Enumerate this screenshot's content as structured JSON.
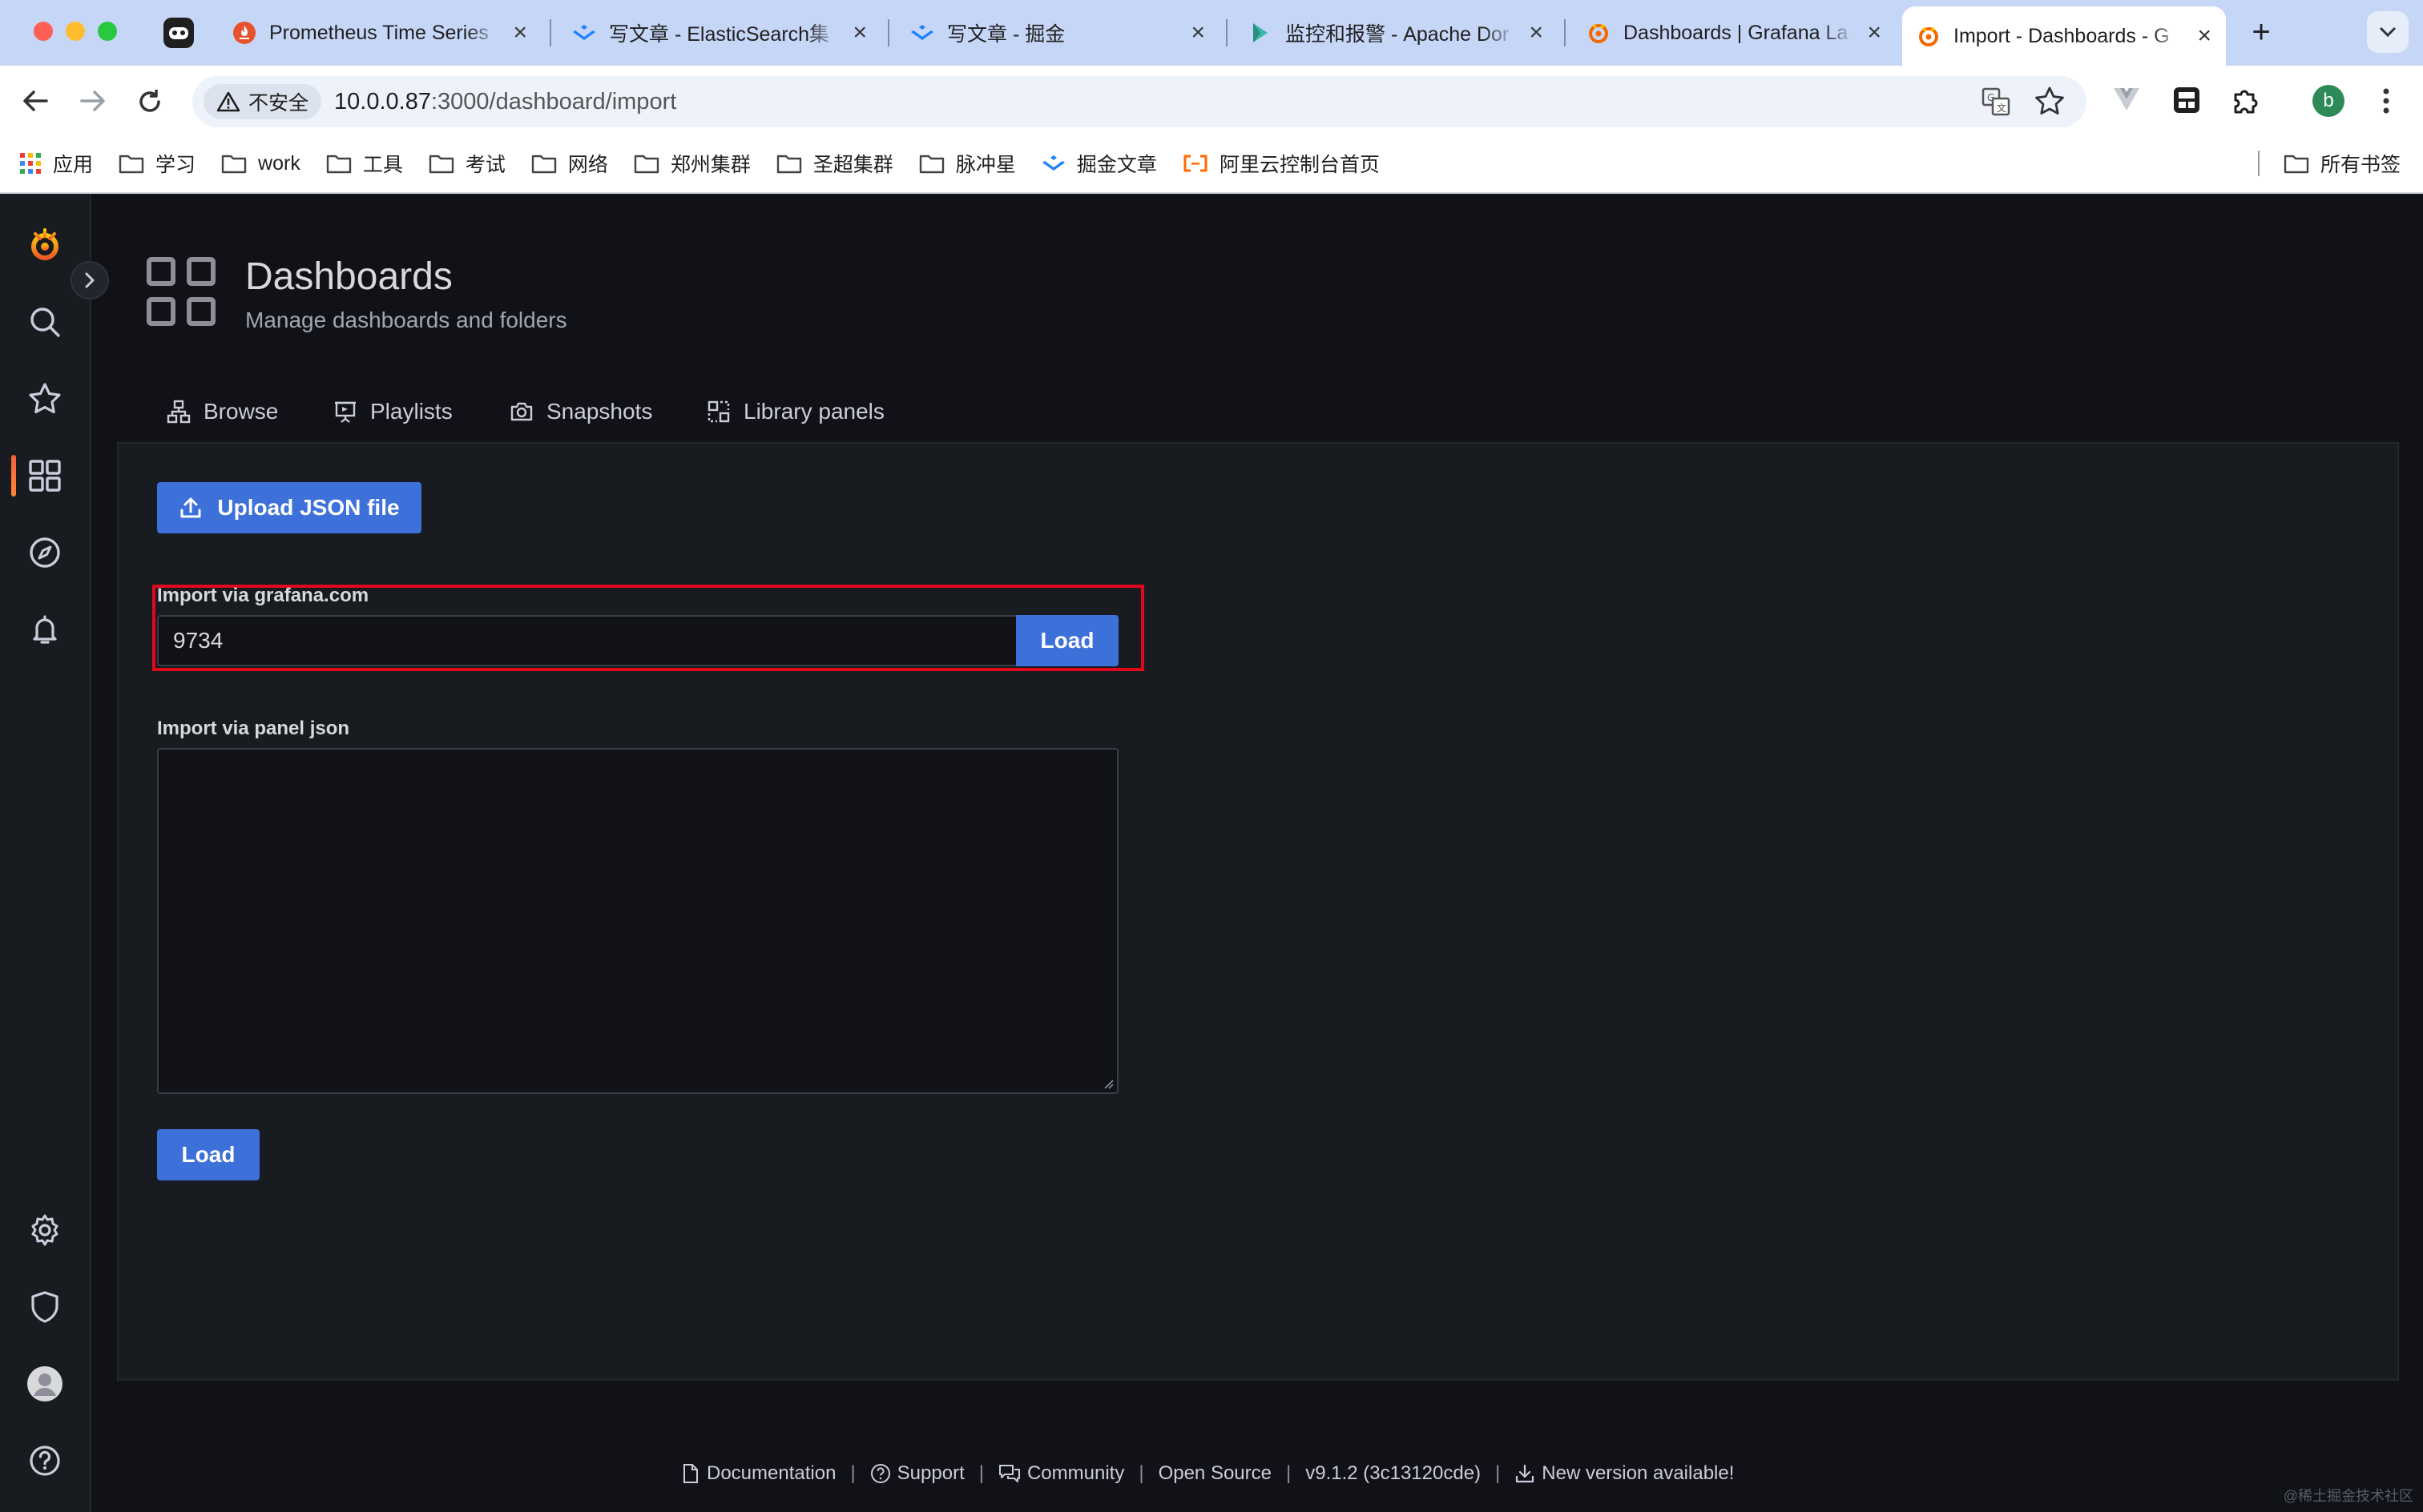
{
  "browser": {
    "traffic_lights": {
      "close": "#ff5f57",
      "minimize": "#febc2e",
      "maximize": "#28c840"
    },
    "tabs": [
      {
        "title": "Prometheus Time Series",
        "icon": "prometheus-icon",
        "active": false
      },
      {
        "title": "写文章 - ElasticSearch集",
        "icon": "juejin-icon",
        "active": false
      },
      {
        "title": "写文章 - 掘金",
        "icon": "juejin-icon",
        "active": false
      },
      {
        "title": "监控和报警 - Apache Dor",
        "icon": "doris-icon",
        "active": false
      },
      {
        "title": "Dashboards | Grafana La",
        "icon": "grafana-icon",
        "active": false
      },
      {
        "title": "Import - Dashboards - G",
        "icon": "grafana-icon",
        "active": true
      }
    ],
    "security_chip": "不安全",
    "url_host": "10.0.0.87",
    "url_path": ":3000/dashboard/import",
    "profile_initial": "b",
    "bookmarks": [
      {
        "label": "应用",
        "icon": "apps-grid-icon"
      },
      {
        "label": "学习",
        "icon": "folder-icon"
      },
      {
        "label": "work",
        "icon": "folder-icon"
      },
      {
        "label": "工具",
        "icon": "folder-icon"
      },
      {
        "label": "考试",
        "icon": "folder-icon"
      },
      {
        "label": "网络",
        "icon": "folder-icon"
      },
      {
        "label": "郑州集群",
        "icon": "folder-icon"
      },
      {
        "label": "圣超集群",
        "icon": "folder-icon"
      },
      {
        "label": "脉冲星",
        "icon": "folder-icon"
      },
      {
        "label": "掘金文章",
        "icon": "juejin-icon"
      },
      {
        "label": "阿里云控制台首页",
        "icon": "aliyun-icon"
      }
    ],
    "all_bookmarks": "所有书签"
  },
  "page": {
    "title": "Dashboards",
    "subtitle": "Manage dashboards and folders",
    "tabs": [
      {
        "label": "Browse",
        "icon": "sitemap-icon"
      },
      {
        "label": "Playlists",
        "icon": "presentation-icon"
      },
      {
        "label": "Snapshots",
        "icon": "camera-icon"
      },
      {
        "label": "Library panels",
        "icon": "library-panels-icon"
      }
    ]
  },
  "import": {
    "upload_label": "Upload JSON file",
    "gcom_label": "Import via grafana.com",
    "gcom_value": "9734",
    "gcom_load": "Load",
    "json_label": "Import via panel json",
    "json_value": "",
    "json_load": "Load"
  },
  "footer": {
    "documentation": "Documentation",
    "support": "Support",
    "community": "Community",
    "open_source": "Open Source",
    "version": "v9.1.2 (3c13120cde)",
    "new_version": "New version available!"
  },
  "watermark": "@稀土掘金技术社区",
  "colors": {
    "primary": "#3d71d9",
    "highlight": "#e0081c",
    "grafana_orange": "#f46800"
  }
}
